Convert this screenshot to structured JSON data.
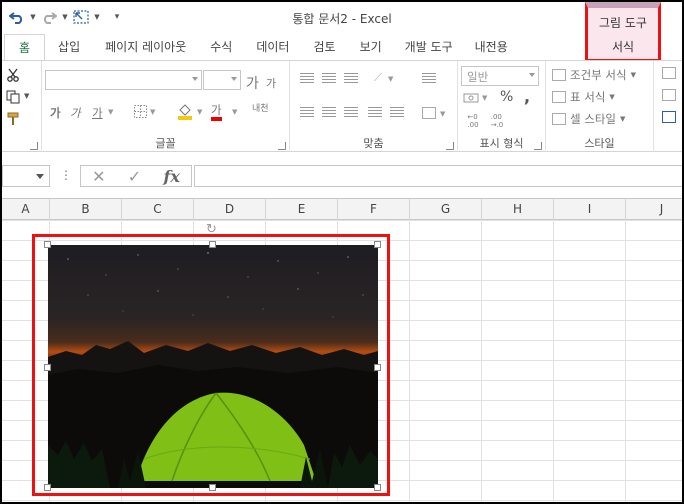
{
  "window": {
    "title": "통합 문서2 - Excel"
  },
  "context_tab": {
    "group_label": "그림 도구",
    "tab_label": "서식"
  },
  "tabs": [
    "홈",
    "삽입",
    "페이지 레이아웃",
    "수식",
    "데이터",
    "검토",
    "보기",
    "개발 도구",
    "내전용"
  ],
  "ribbon": {
    "font_group": {
      "label": "글꼴",
      "grow": "가",
      "shrink": "가",
      "bold": "가",
      "italic": "가",
      "underline": "가",
      "font_color": "가",
      "phonetic": "내천"
    },
    "align_group": {
      "label": "맞춤"
    },
    "number_group": {
      "label": "표시 형식",
      "format_value": "일반",
      "percent": "%",
      "comma": ","
    },
    "styles_group": {
      "label": "스타일",
      "conditional": "조건부 서식",
      "table_format": "표 서식",
      "cell_styles": "셀 스타일"
    }
  },
  "formula_bar": {
    "dots": "⋮",
    "cancel": "✕",
    "enter": "✓",
    "fx": "fx"
  },
  "columns": [
    "A",
    "B",
    "C",
    "D",
    "E",
    "F",
    "G",
    "H",
    "I",
    "J"
  ],
  "colors": {
    "accent": "#217346",
    "highlight": "#ee1111",
    "context_bg": "#fbe6ee"
  }
}
